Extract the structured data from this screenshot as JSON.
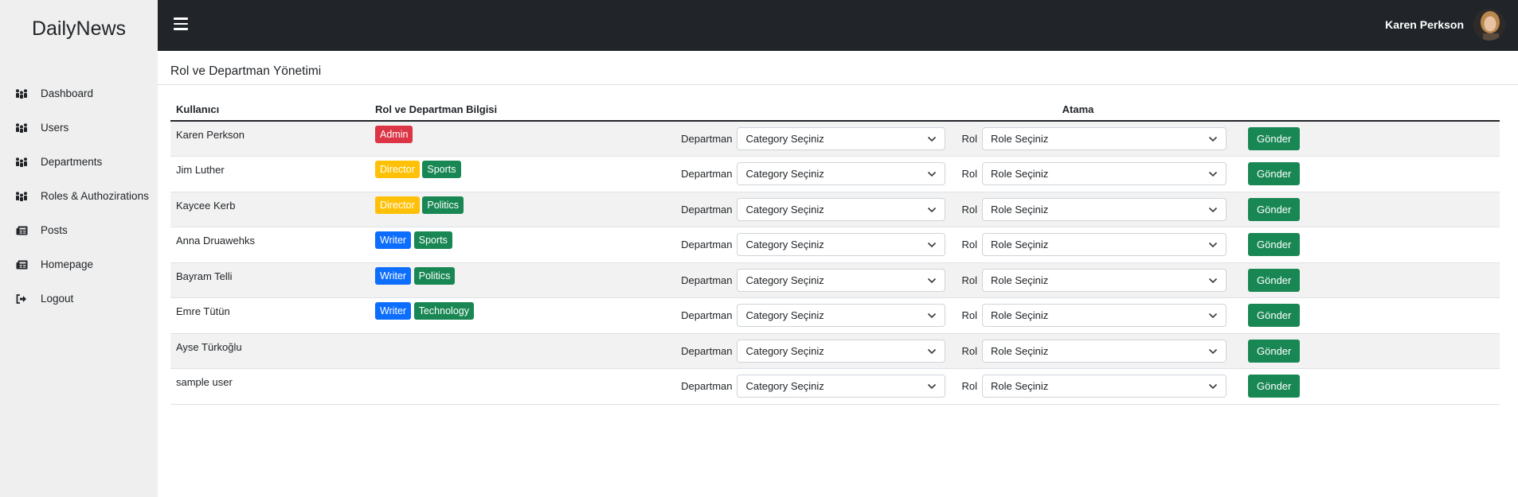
{
  "app": {
    "brand": "DailyNews"
  },
  "topbar": {
    "user_name": "Karen Perkson"
  },
  "sidebar": {
    "items": [
      {
        "label": "Dashboard",
        "icon": "users-icon"
      },
      {
        "label": "Users",
        "icon": "users-icon"
      },
      {
        "label": "Departments",
        "icon": "users-icon"
      },
      {
        "label": "Roles & Authozirations",
        "icon": "users-icon"
      },
      {
        "label": "Posts",
        "icon": "newspaper-icon"
      },
      {
        "label": "Homepage",
        "icon": "newspaper-icon"
      },
      {
        "label": "Logout",
        "icon": "sign-out-icon"
      }
    ]
  },
  "page": {
    "title": "Rol ve Departman Yönetimi"
  },
  "table": {
    "headers": {
      "user": "Kullanıcı",
      "info": "Rol ve Departman Bilgisi",
      "assign": "Atama"
    },
    "dept_label": "Departman",
    "role_label": "Rol",
    "dept_placeholder": "Category Seçiniz",
    "role_placeholder": "Role Seçiniz",
    "submit_label": "Gönder",
    "rows": [
      {
        "user": "Karen Perkson",
        "role": "Admin",
        "dept": ""
      },
      {
        "user": "Jim Luther",
        "role": "Director",
        "dept": "Sports"
      },
      {
        "user": "Kaycee Kerb",
        "role": "Director",
        "dept": "Politics"
      },
      {
        "user": "Anna Druawehks",
        "role": "Writer",
        "dept": "Sports"
      },
      {
        "user": "Bayram Telli",
        "role": "Writer",
        "dept": "Politics"
      },
      {
        "user": "Emre Tütün",
        "role": "Writer",
        "dept": "Technology"
      },
      {
        "user": "Ayse Türkoğlu",
        "role": "",
        "dept": ""
      },
      {
        "user": "sample user",
        "role": "",
        "dept": ""
      }
    ]
  },
  "colors": {
    "topbar": "#212529",
    "sidebar": "#efefef",
    "admin_badge": "#dc3545",
    "director_badge": "#ffc107",
    "writer_badge": "#0d6efd",
    "dept_badge": "#198754",
    "submit_button": "#198754"
  }
}
